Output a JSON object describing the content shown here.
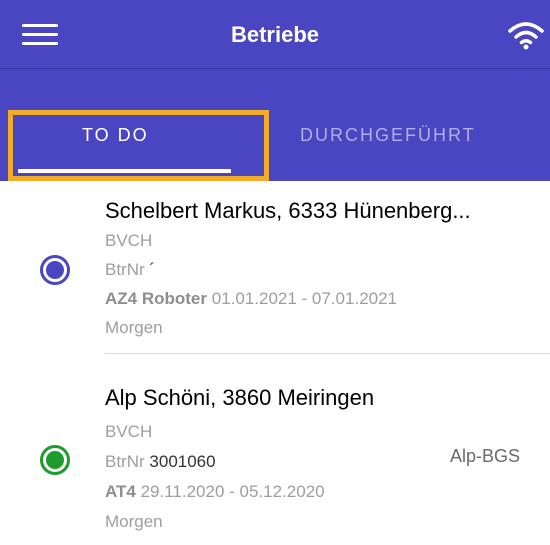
{
  "header": {
    "title": "Betriebe",
    "menu_icon": "hamburger-menu-icon",
    "status_icon": "wifi-icon",
    "bar_color": "#4a45c0"
  },
  "tabs": [
    {
      "label": "TO DO",
      "active": true
    },
    {
      "label": "DURCHGEFÜHRT",
      "active": false
    }
  ],
  "highlight_color": "#f2ac2a",
  "items": [
    {
      "name": "Schelbert Markus, 6333 Hünenberg...",
      "org": "BVCH",
      "btrnr_label": "BtrNr",
      "btrnr_value": "´",
      "program": "AZ4 Roboter",
      "period": "01.01.2021 - 07.01.2021",
      "when": "Morgen",
      "side_label": "",
      "status_color": "#4a45c0"
    },
    {
      "name": "Alp Schöni, 3860 Meiringen",
      "org": "BVCH",
      "btrnr_label": "BtrNr",
      "btrnr_value": "3001060",
      "program": "AT4",
      "period": "29.11.2020 - 05.12.2020",
      "when": "Morgen",
      "side_label": "Alp-BGS",
      "status_color": "#1e9b2a"
    }
  ]
}
